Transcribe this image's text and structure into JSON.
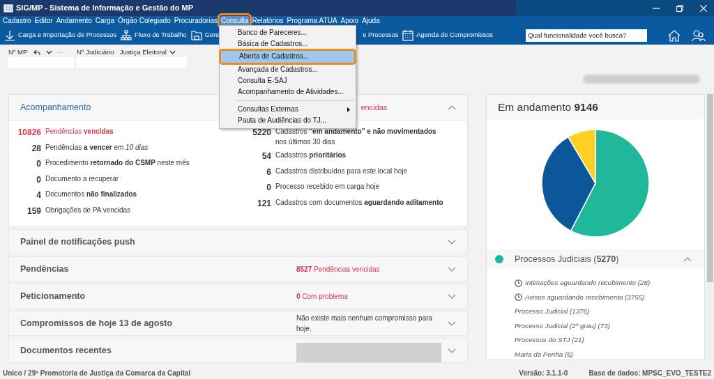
{
  "window": {
    "title": "SIG/MP - Sistema de Informação e Gestão do MP"
  },
  "menu_bar": [
    {
      "label": "Cadastro",
      "selected": false
    },
    {
      "label": "Editor",
      "selected": false
    },
    {
      "label": "Andamento",
      "selected": false
    },
    {
      "label": "Carga",
      "selected": false
    },
    {
      "label": "Órgão Colegiado",
      "selected": false
    },
    {
      "label": "Procuradorias",
      "selected": false
    },
    {
      "label": "Consulta",
      "selected": true
    },
    {
      "label": "Relatórios",
      "selected": false
    },
    {
      "label": "Programa ATUA",
      "selected": false
    },
    {
      "label": "Apoio",
      "selected": false
    },
    {
      "label": "Ajuda",
      "selected": false
    }
  ],
  "toolbar": [
    {
      "label": "Carga e Importação de Processos",
      "kind": "download"
    },
    {
      "label": "Fluxo de Trabalho",
      "kind": "flow"
    },
    {
      "label": "Gere",
      "kind": "folder"
    },
    {
      "label": "e Processos",
      "kind": "plain"
    },
    {
      "label": "Agenda de Compromissos",
      "kind": "calendar"
    }
  ],
  "search": {
    "placeholder": "Qual funcionalidade você busca?"
  },
  "dropdown": [
    {
      "label": "Banco de Pareceres...",
      "kind": "item",
      "selected": false
    },
    {
      "label": "Básica de Cadastros...",
      "kind": "item",
      "selected": false
    },
    {
      "label": "Aberta de Cadastros...",
      "kind": "item",
      "selected": true
    },
    {
      "label": "Avançada de Cadastros...",
      "kind": "item",
      "selected": false
    },
    {
      "label": "Consulta E-SAJ",
      "kind": "item",
      "selected": false
    },
    {
      "label": "Acompanhamento de Atividades...",
      "kind": "item",
      "selected": false
    },
    {
      "label": "Consultas Externas",
      "kind": "submenu",
      "selected": false
    },
    {
      "label": "Pauta de Audiências do TJ...",
      "kind": "item",
      "selected": false
    }
  ],
  "filters": {
    "mp_label": "Nº MP",
    "more": "···",
    "judicial_label": "Nº Judiciário",
    "court": "Justiça Eleitoral"
  },
  "blurred_bar": {
    "kind": "redacted"
  },
  "acompanhamento": {
    "title": "Acompanhamento",
    "header_info": "encidas",
    "expanded": true,
    "left": [
      {
        "count": "10826",
        "text": "Pendências **vencidas**",
        "alert": true
      },
      {
        "count": "28",
        "text": "Pendências **a vencer** em *10 dias*",
        "alert": false
      },
      {
        "count": "0",
        "text": "Procedimento **retornado do CSMP** neste mês",
        "alert": false
      },
      {
        "count": "0",
        "text": "Documento a recuperar",
        "alert": false
      },
      {
        "count": "4",
        "text": "Documentos **não finalizados**",
        "alert": false
      },
      {
        "count": "159",
        "text": "Obrigações de PA vencidas",
        "alert": false
      }
    ],
    "right": [
      {
        "count": "5220",
        "text": "Cadastros **\"em andamento\" e não movimentados** nos últimos 30 dias",
        "alert": false
      },
      {
        "count": "54",
        "text": "Cadastros **prioritários**",
        "alert": false
      },
      {
        "count": "6",
        "text": "Cadastros distribuídos para este local hoje",
        "alert": false
      },
      {
        "count": "0",
        "text": "Processo recebido em carga hoje",
        "alert": false
      },
      {
        "count": "121",
        "text": "Cadastros com documentos **aguardando aditamento**",
        "alert": false
      }
    ]
  },
  "panels": [
    {
      "title": "Painel de notificações push",
      "kind": "empty",
      "expanded": false
    },
    {
      "title": "Pendências",
      "kind": "alert",
      "info": "**8527** Pendências vencidas",
      "expanded": false
    },
    {
      "title": "Peticionamento",
      "kind": "alert",
      "info": "**0** Com problema",
      "expanded": false
    },
    {
      "title": "Compromissos de hoje 13 de agosto",
      "kind": "note",
      "info": "Não existe mais nenhum compromisso para hoje.",
      "expanded": false
    },
    {
      "title": "Documentos recentes",
      "kind": "redacted",
      "expanded": false
    }
  ],
  "summary": {
    "title": "Em andamento **9146**",
    "group": {
      "label": "Processos Judiciais (**5270**)",
      "color": "#1fb89a",
      "expanded": true,
      "items": [
        {
          "text": "Intimações aguardando recebimento (28)",
          "kind": "timed"
        },
        {
          "text": "Avisos aguardando recebimento (3755)",
          "kind": "timed"
        },
        {
          "text": "Processo Judicial (1376)",
          "kind": "plain"
        },
        {
          "text": "Processo Judicial (2º grau) (73)",
          "kind": "plain"
        },
        {
          "text": "Processos do STJ (21)",
          "kind": "plain"
        },
        {
          "text": "Maria da Penha (6)",
          "kind": "plain"
        }
      ]
    }
  },
  "status_bar": {
    "location": "Unico / 29ª Promotoria de Justiça da Comarca da Capital",
    "version": "Versão: 3.1.1-0",
    "database": "Base de dados: MPSC_EVO_TESTE2"
  }
}
